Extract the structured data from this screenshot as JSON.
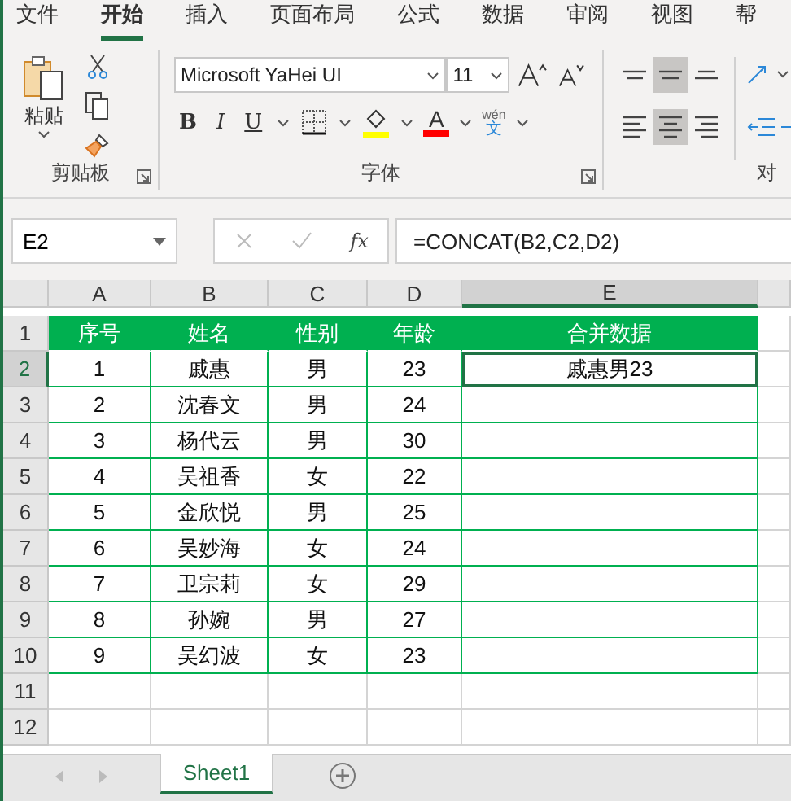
{
  "menu_tabs": [
    {
      "label": "文件",
      "selected": false
    },
    {
      "label": "开始",
      "selected": true
    },
    {
      "label": "插入",
      "selected": false
    },
    {
      "label": "页面布局",
      "selected": false
    },
    {
      "label": "公式",
      "selected": false
    },
    {
      "label": "数据",
      "selected": false
    },
    {
      "label": "审阅",
      "selected": false
    },
    {
      "label": "视图",
      "selected": false
    },
    {
      "label": "帮",
      "selected": false
    }
  ],
  "ribbon": {
    "clipboard": {
      "paste_label": "粘贴",
      "group_label": "剪贴板"
    },
    "font": {
      "font_name": "Microsoft YaHei UI",
      "font_size": "11",
      "bold": "B",
      "italic": "I",
      "underline": "U",
      "font_color": "A",
      "phonetic_top": "wén",
      "phonetic_bottom": "文",
      "group_label": "字体"
    },
    "alignment": {
      "group_label": "对",
      "buttons": [
        {
          "kind": "top",
          "selected": false
        },
        {
          "kind": "middle",
          "selected": true
        },
        {
          "kind": "bottom",
          "selected": false
        },
        {
          "kind": "left",
          "selected": false
        },
        {
          "kind": "center",
          "selected": true
        },
        {
          "kind": "right",
          "selected": false
        }
      ]
    }
  },
  "formula_bar": {
    "name_box": "E2",
    "fx": "fx",
    "formula": "=CONCAT(B2,C2,D2)"
  },
  "columns": [
    {
      "label": "A",
      "selected": false
    },
    {
      "label": "B",
      "selected": false
    },
    {
      "label": "C",
      "selected": false
    },
    {
      "label": "D",
      "selected": false
    },
    {
      "label": "E",
      "selected": true
    }
  ],
  "rows": [
    {
      "number": "1",
      "kind": "header",
      "cells": [
        {
          "text": "序号",
          "selected": false
        },
        {
          "text": "姓名",
          "selected": false
        },
        {
          "text": "性别",
          "selected": false
        },
        {
          "text": "年龄",
          "selected": false
        },
        {
          "text": "合并数据",
          "selected": false
        }
      ]
    },
    {
      "number": "2",
      "kind": "data",
      "cells": [
        {
          "text": "1",
          "selected": false
        },
        {
          "text": "戚惠",
          "selected": false
        },
        {
          "text": "男",
          "selected": false
        },
        {
          "text": "23",
          "selected": false
        },
        {
          "text": "戚惠男23",
          "selected": true
        }
      ]
    },
    {
      "number": "3",
      "kind": "data",
      "cells": [
        {
          "text": "2",
          "selected": false
        },
        {
          "text": "沈春文",
          "selected": false
        },
        {
          "text": "男",
          "selected": false
        },
        {
          "text": "24",
          "selected": false
        }
      ]
    },
    {
      "number": "4",
      "kind": "data",
      "cells": [
        {
          "text": "3",
          "selected": false
        },
        {
          "text": "杨代云",
          "selected": false
        },
        {
          "text": "男",
          "selected": false
        },
        {
          "text": "30",
          "selected": false
        }
      ]
    },
    {
      "number": "5",
      "kind": "data",
      "cells": [
        {
          "text": "4",
          "selected": false
        },
        {
          "text": "吴祖香",
          "selected": false
        },
        {
          "text": "女",
          "selected": false
        },
        {
          "text": "22",
          "selected": false
        }
      ]
    },
    {
      "number": "6",
      "kind": "data",
      "cells": [
        {
          "text": "5",
          "selected": false
        },
        {
          "text": "金欣悦",
          "selected": false
        },
        {
          "text": "男",
          "selected": false
        },
        {
          "text": "25",
          "selected": false
        }
      ]
    },
    {
      "number": "7",
      "kind": "data",
      "cells": [
        {
          "text": "6",
          "selected": false
        },
        {
          "text": "吴妙海",
          "selected": false
        },
        {
          "text": "女",
          "selected": false
        },
        {
          "text": "24",
          "selected": false
        }
      ]
    },
    {
      "number": "8",
      "kind": "data",
      "cells": [
        {
          "text": "7",
          "selected": false
        },
        {
          "text": "卫宗莉",
          "selected": false
        },
        {
          "text": "女",
          "selected": false
        },
        {
          "text": "29",
          "selected": false
        }
      ]
    },
    {
      "number": "9",
      "kind": "data",
      "cells": [
        {
          "text": "8",
          "selected": false
        },
        {
          "text": "孙婉",
          "selected": false
        },
        {
          "text": "男",
          "selected": false
        },
        {
          "text": "27",
          "selected": false
        }
      ]
    },
    {
      "number": "10",
      "kind": "data",
      "cells": [
        {
          "text": "9",
          "selected": false
        },
        {
          "text": "吴幻波",
          "selected": false
        },
        {
          "text": "女",
          "selected": false
        },
        {
          "text": "23",
          "selected": false
        }
      ]
    },
    {
      "number": "11",
      "kind": "empty",
      "cells": []
    },
    {
      "number": "12",
      "kind": "empty",
      "cells": []
    }
  ],
  "sheet_tabs": [
    {
      "label": "Sheet1",
      "selected": true
    }
  ]
}
